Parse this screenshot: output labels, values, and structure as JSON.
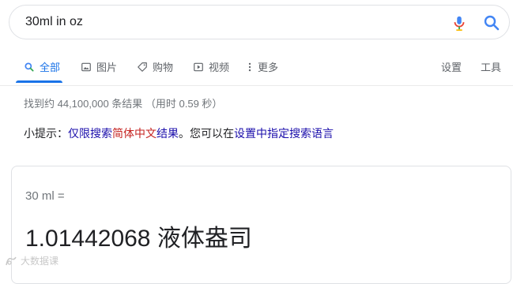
{
  "search": {
    "query": "30ml in oz"
  },
  "tabs": [
    {
      "label": "全部",
      "icon": "search-icon",
      "active": true
    },
    {
      "label": "图片",
      "icon": "image-icon"
    },
    {
      "label": "购物",
      "icon": "tag-icon"
    },
    {
      "label": "视频",
      "icon": "play-icon"
    },
    {
      "label": "更多",
      "icon": "more-vert-icon"
    },
    {
      "label": "设置"
    },
    {
      "label": "工具"
    }
  ],
  "stats": "找到约 44,100,000 条结果  （用时 0.59 秒）",
  "tip": {
    "prefix": "小提示：",
    "link1": "仅限搜索",
    "highlight": "简体中文",
    "link2": "结果",
    "middle": "。您可以在",
    "settings_link": "设置",
    "suffix": "中指定搜索语言"
  },
  "converter": {
    "input": "30 ml =",
    "result": "1.01442068 液体盎司"
  },
  "watermark": "大数据课",
  "colors": {
    "accent": "#1a73e8",
    "link": "#1a0dab",
    "highlight": "#c5221f"
  }
}
